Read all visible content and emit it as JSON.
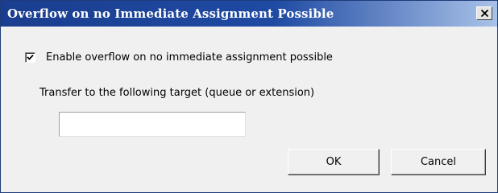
{
  "dialog": {
    "title": "Overflow on no Immediate Assignment Possible",
    "close_icon": "close-icon"
  },
  "overflow_checkbox": {
    "label": "Enable overflow on no immediate assignment possible",
    "checked": true
  },
  "transfer": {
    "label": "Transfer to the following target (queue or extension)",
    "value": ""
  },
  "buttons": {
    "ok_label": "OK",
    "cancel_label": "Cancel"
  }
}
